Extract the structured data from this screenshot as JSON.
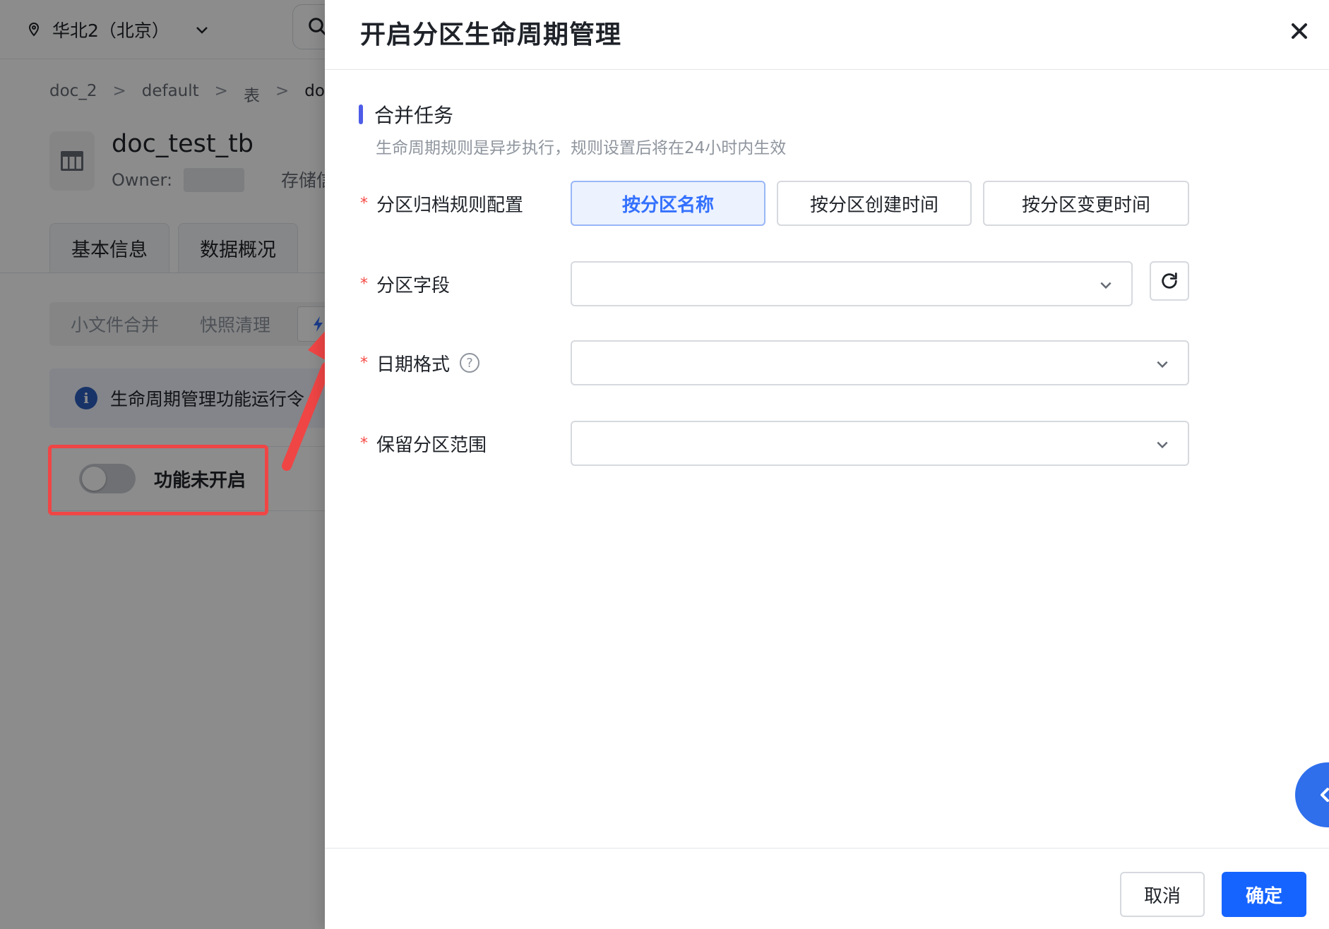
{
  "background": {
    "region": "华北2（北京）",
    "breadcrumb": [
      "doc_2",
      "default",
      "表",
      "doc_"
    ],
    "table_name": "doc_test_tb",
    "owner_label": "Owner:",
    "storage_label": "存储信",
    "main_tabs": [
      "基本信息",
      "数据概况"
    ],
    "sub_tabs": [
      "小文件合并",
      "快照清理"
    ],
    "info_text": "生命周期管理功能运行令",
    "toggle_label": "功能未开启",
    "toggle_on": false
  },
  "drawer": {
    "title": "开启分区生命周期管理",
    "section": {
      "title": "合并任务",
      "desc": "生命周期规则是异步执行，规则设置后将在24小时内生效"
    },
    "fields": {
      "archive_rule": {
        "label": "分区归档规则配置",
        "options": [
          "按分区名称",
          "按分区创建时间",
          "按分区变更时间"
        ],
        "selected": "按分区名称"
      },
      "partition_field": {
        "label": "分区字段",
        "value": ""
      },
      "date_format": {
        "label": "日期格式",
        "value": ""
      },
      "retention_range": {
        "label": "保留分区范围",
        "value": ""
      }
    },
    "footer": {
      "cancel": "取消",
      "confirm": "确定"
    }
  },
  "colors": {
    "accent": "#3370ff",
    "primary_button": "#1664ff",
    "required": "#f54a45",
    "highlight": "#f04545",
    "section_bar": "#4e5ce8"
  },
  "icons": [
    "location-pin-icon",
    "chevron-down-icon",
    "search-icon",
    "table-icon",
    "info-icon",
    "close-icon",
    "help-icon",
    "refresh-icon",
    "chevron-left-icon"
  ]
}
